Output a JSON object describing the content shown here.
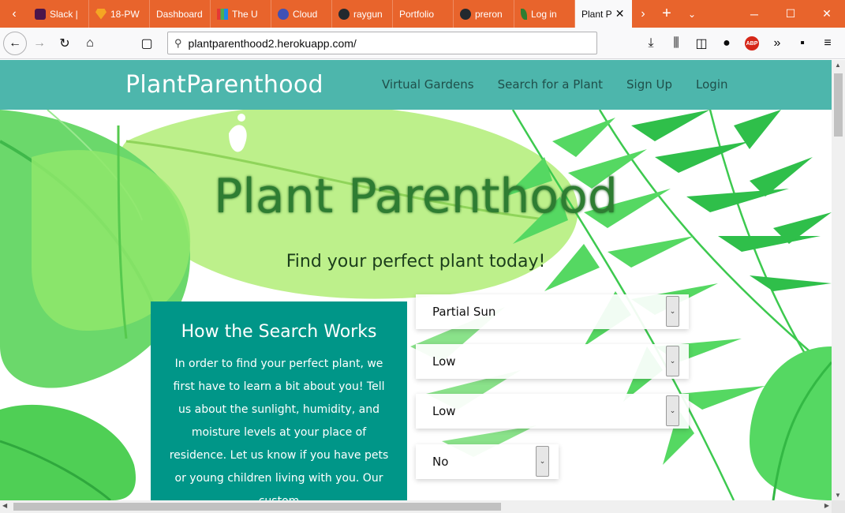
{
  "browser": {
    "tabs": [
      {
        "label": "Slack |",
        "icon": "slack-icon",
        "color": "#4a154b"
      },
      {
        "label": "18-PW",
        "icon": "gem-icon",
        "color": "#f5a623"
      },
      {
        "label": "Dashboard",
        "icon": "dashboard-icon",
        "color": "#ffffff"
      },
      {
        "label": "The U",
        "icon": "chart-icon",
        "color": "#4caf50"
      },
      {
        "label": "Cloud",
        "icon": "cloud-icon",
        "color": "#3f51b5"
      },
      {
        "label": "raygun",
        "icon": "github-icon",
        "color": "#24292e"
      },
      {
        "label": "Portfolio",
        "icon": "portfolio-icon",
        "color": "#ffffff"
      },
      {
        "label": "preron",
        "icon": "github-icon",
        "color": "#24292e"
      },
      {
        "label": "Log in",
        "icon": "leaf-icon",
        "color": "#2e7d32"
      }
    ],
    "active_tab": {
      "label": "Plant P",
      "close": "✕"
    },
    "url": "plantparenthood2.herokuapp.com/",
    "controls": {
      "minimize": "─",
      "maximize": "☐",
      "close": "✕"
    }
  },
  "site": {
    "brand": "PlantParenthood",
    "nav": [
      "Virtual Gardens",
      "Search for a Plant",
      "Sign Up",
      "Login"
    ],
    "title": "Plant Parenthood",
    "subtitle": "Find your perfect plant today!",
    "info": {
      "heading": "How the Search Works",
      "body": "In order to find your perfect plant, we first have to learn a bit about you! Tell us about the sunlight, humidity, and moisture levels at your place of residence. Let us know if you have pets or young children living with you. Our custom"
    },
    "selects": [
      {
        "value": "Partial Sun"
      },
      {
        "value": "Low"
      },
      {
        "value": "Low"
      },
      {
        "value": "No"
      }
    ]
  },
  "colors": {
    "tabbar": "#e8642c",
    "navbar": "#4db6ac",
    "card": "#009688",
    "leaf_light": "#a5e86b",
    "leaf_mid": "#5fd35f",
    "leaf_dark": "#2fbf4a"
  }
}
